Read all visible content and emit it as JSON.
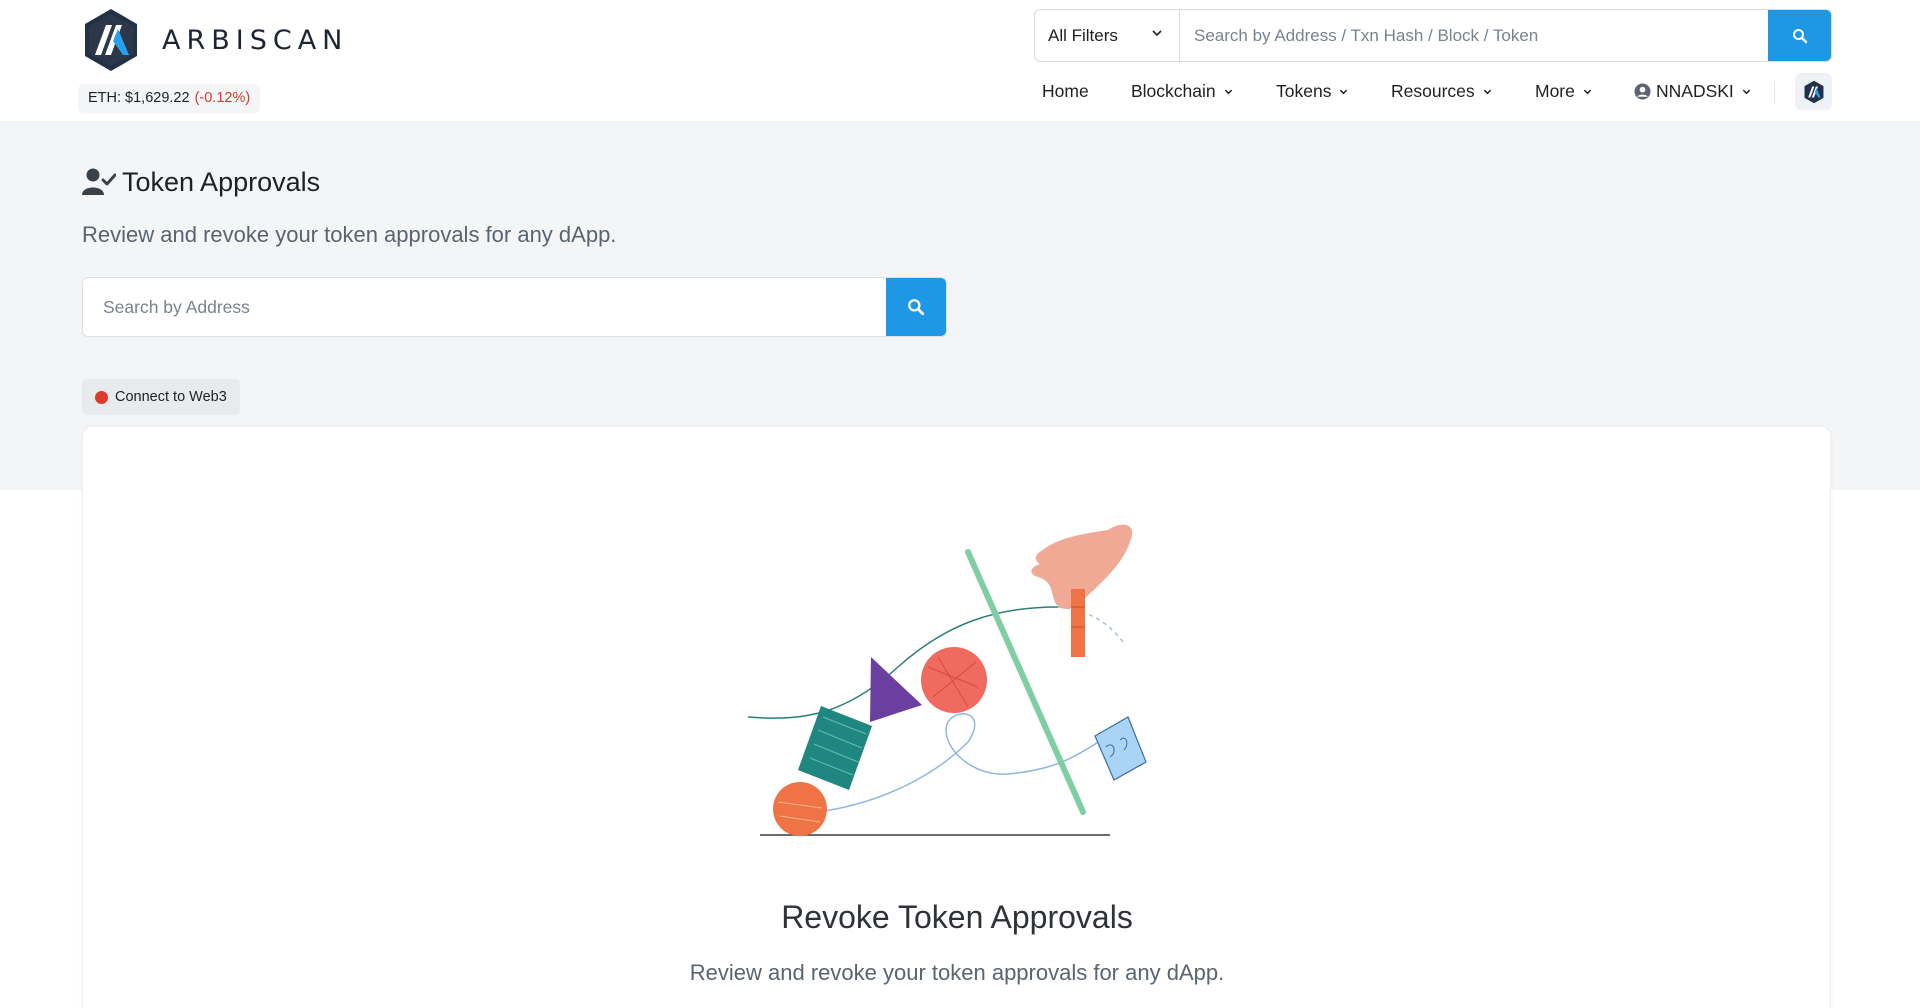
{
  "brand": {
    "name": "ARBISCAN",
    "logo_icon": "arbitrum-logo-icon"
  },
  "eth_price": {
    "label": "ETH: $1,629.22",
    "change": "(-0.12%)"
  },
  "search": {
    "filter": "All Filters",
    "placeholder": "Search by Address / Txn Hash / Block / Token",
    "icon": "search-icon"
  },
  "nav": {
    "items": [
      {
        "label": "Home",
        "dropdown": false
      },
      {
        "label": "Blockchain",
        "dropdown": true
      },
      {
        "label": "Tokens",
        "dropdown": true
      },
      {
        "label": "Resources",
        "dropdown": true
      },
      {
        "label": "More",
        "dropdown": true
      },
      {
        "label": "NNADSKI",
        "dropdown": true,
        "icon": "user-circle-icon"
      }
    ],
    "chain_icon": "arbitrum-logo-icon"
  },
  "page": {
    "title": "Token Approvals",
    "title_icon": "user-check-icon",
    "subtitle": "Review and revoke your token approvals for any dApp.",
    "address_search_placeholder": "Search by Address",
    "connect_label": "Connect to Web3",
    "connect_status_color": "#db3b2c"
  },
  "card": {
    "title": "Revoke Token Approvals",
    "subtitle": "Review and revoke your token approvals for any dApp."
  },
  "colors": {
    "accent": "#1e97e5",
    "negative": "#d63a2f",
    "band_bg": "#f4f5f7"
  }
}
